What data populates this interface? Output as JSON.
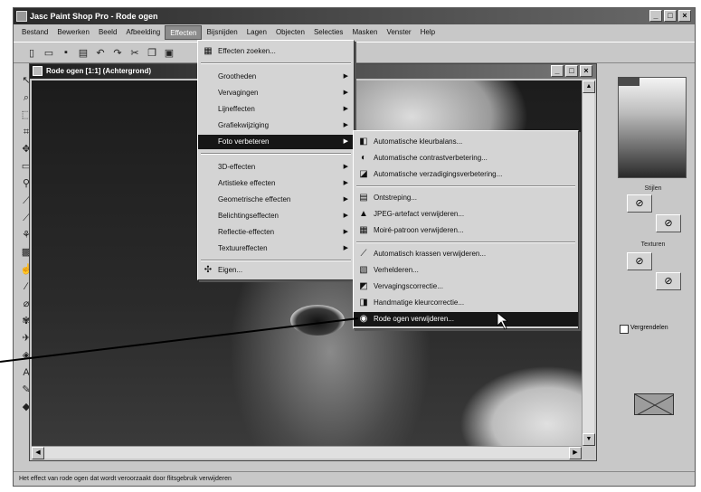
{
  "app": {
    "title": "Jasc Paint Shop Pro - Rode ogen",
    "window_buttons": [
      "_",
      "□",
      "×"
    ]
  },
  "menubar": [
    "Bestand",
    "Bewerken",
    "Beeld",
    "Afbeelding",
    "Effecten",
    "Bijsnijden",
    "Lagen",
    "Objecten",
    "Selecties",
    "Masken",
    "Venster",
    "Help"
  ],
  "document": {
    "title": "Rode ogen [1:1] (Achtergrond)",
    "window_buttons": [
      "_",
      "□",
      "×"
    ]
  },
  "effects_menu": {
    "browser": "Effecten zoeken...",
    "groups": [
      "Grootheden",
      "Vervagingen",
      "Lijneffecten",
      "Grafiekwijziging",
      "Foto verbeteren"
    ],
    "groups2": [
      "3D-effecten",
      "Artistieke effecten",
      "Geometrische effecten",
      "Belichtingseffecten",
      "Reflectie-effecten",
      "Textuureffecten"
    ],
    "last": "Eigen..."
  },
  "submenu": {
    "items_a": [
      "Automatische kleurbalans...",
      "Automatische contrastverbetering...",
      "Automatische verzadigingsverbetering..."
    ],
    "items_b": [
      "Ontstreping...",
      "JPEG-artefact verwijderen...",
      "Moiré-patroon verwijderen..."
    ],
    "items_c": [
      "Automatisch krassen verwijderen...",
      "Verhelderen...",
      "Vervagingscorrectie...",
      "Handmatige kleurcorrectie...",
      "Rode ogen verwijderen..."
    ]
  },
  "right_panel": {
    "styles_label": "Stijlen",
    "textures_label": "Texturen",
    "lock_label": "Vergrendelen"
  },
  "statusbar": {
    "text": "Het effect van rode ogen dat wordt veroorzaakt door flitsgebruik verwijderen"
  },
  "colors": {
    "highlight": "#161616",
    "titlebar": "#2a2a2a",
    "menu_bg": "#d4d4d4",
    "app_bg": "#c8c8c8"
  }
}
